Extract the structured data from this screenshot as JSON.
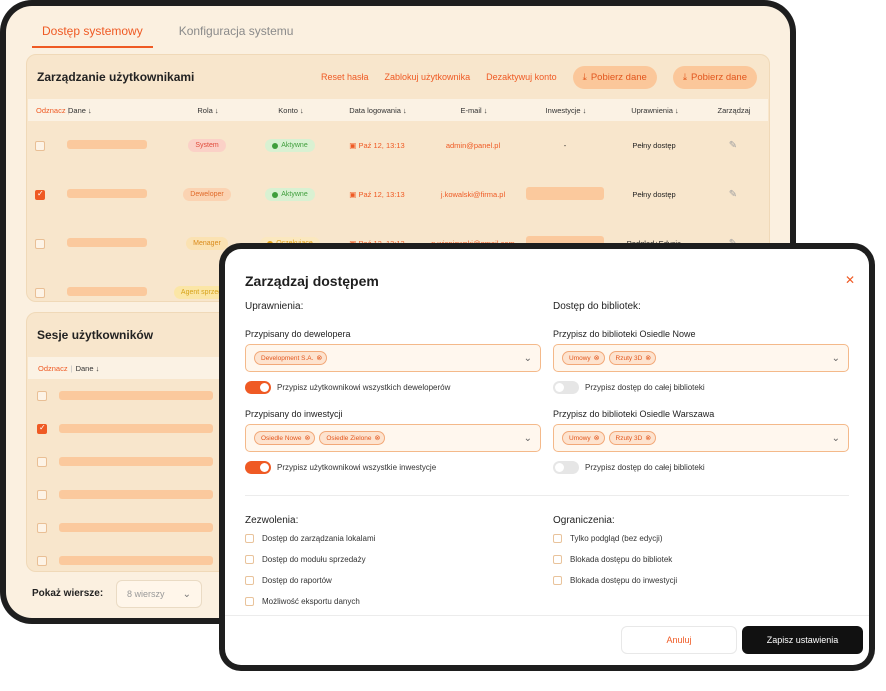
{
  "tabs": [
    {
      "label": "Dostęp systemowy",
      "active": true
    },
    {
      "label": "Konfiguracja systemu",
      "active": false
    }
  ],
  "users_panel": {
    "title": "Zarządzanie użytkownikami",
    "actions": {
      "reset_password": "Reset hasła",
      "block_user": "Zablokuj użytkownika",
      "deactivate_account": "Dezaktywuj konto",
      "download1": "Pobierz dane",
      "download2": "Pobierz dane"
    },
    "columns": [
      "Odznacz",
      "Dane",
      "Rola",
      "Konto",
      "Data logowania",
      "E-mail",
      "Inwestycje",
      "Uprawnienia",
      "Zarządzaj"
    ],
    "rows": [
      {
        "checked": false,
        "role": "System",
        "role_style": "system",
        "status": "Aktywne",
        "status_style": "active",
        "date": "Paź 12, 13:13",
        "email": "admin@panel.pl",
        "investments": "-",
        "permissions": "Pełny dostęp"
      },
      {
        "checked": true,
        "role": "Deweloper",
        "role_style": "dev",
        "status": "Aktywne",
        "status_style": "active",
        "date": "Paź 12, 13:13",
        "email": "j.kowalski@firma.pl",
        "investments": "",
        "permissions": "Pełny dostęp"
      },
      {
        "checked": false,
        "role": "Menager",
        "role_style": "man",
        "status": "Oczekujące",
        "status_style": "pending",
        "date": "Paź 12, 13:13",
        "email": "p.wisniewski@gmail.com",
        "investments": "",
        "permissions": "Podgląd+Edycja"
      },
      {
        "checked": false,
        "role": "Agent sprzedaży",
        "role_style": "agent",
        "status": "",
        "status_style": "",
        "date": "",
        "email": "",
        "investments": "",
        "permissions": ""
      }
    ]
  },
  "sessions_panel": {
    "title": "Sesje użytkowników",
    "col_unmark": "Odznacz",
    "col_data": "Dane",
    "rows_checked": [
      false,
      true,
      false,
      false,
      false,
      false
    ]
  },
  "pagination": {
    "label": "Pokaż wiersze:",
    "value": "8 wierszy"
  },
  "modal": {
    "title": "Zarządzaj dostępem",
    "permissions_title": "Uprawnienia:",
    "libraries_title": "Dostęp do bibliotek:",
    "developer_label": "Przypisany do dewelopera",
    "developer_chips": [
      "Development S.A."
    ],
    "developer_toggle": "Przypisz użytkownikowi wszystkich deweloperów",
    "investment_label": "Przypisany do inwestycji",
    "investment_chips": [
      "Osiedle Nowe",
      "Osiedle Zielone"
    ],
    "investment_toggle": "Przypisz użytkownikowi wszystkie inwestycje",
    "lib1_label": "Przypisz do biblioteki Osiedle Nowe",
    "lib1_chips": [
      "Umowy",
      "Rzuty 3D"
    ],
    "lib1_toggle": "Przypisz dostęp do całej biblioteki",
    "lib2_label": "Przypisz do biblioteki Osiedle Warszawa",
    "lib2_chips": [
      "Umowy",
      "Rzuty 3D"
    ],
    "lib2_toggle": "Przypisz dostęp do całej biblioteki",
    "consents_title": "Zezwolenia:",
    "consents": [
      "Dostęp do zarządzania lokalami",
      "Dostęp do modułu sprzedaży",
      "Dostęp do raportów",
      "Możliwość eksportu danych"
    ],
    "restrictions_title": "Ograniczenia:",
    "restrictions": [
      "Tylko podgląd (bez edycji)",
      "Blokada dostępu do bibliotek",
      "Blokada dostępu do inwestycji"
    ],
    "cancel": "Anuluj",
    "save": "Zapisz ustawienia"
  },
  "colors": {
    "accent": "#ef5a24",
    "panel_bg": "#f8e6cc",
    "save_bg": "#111111"
  }
}
